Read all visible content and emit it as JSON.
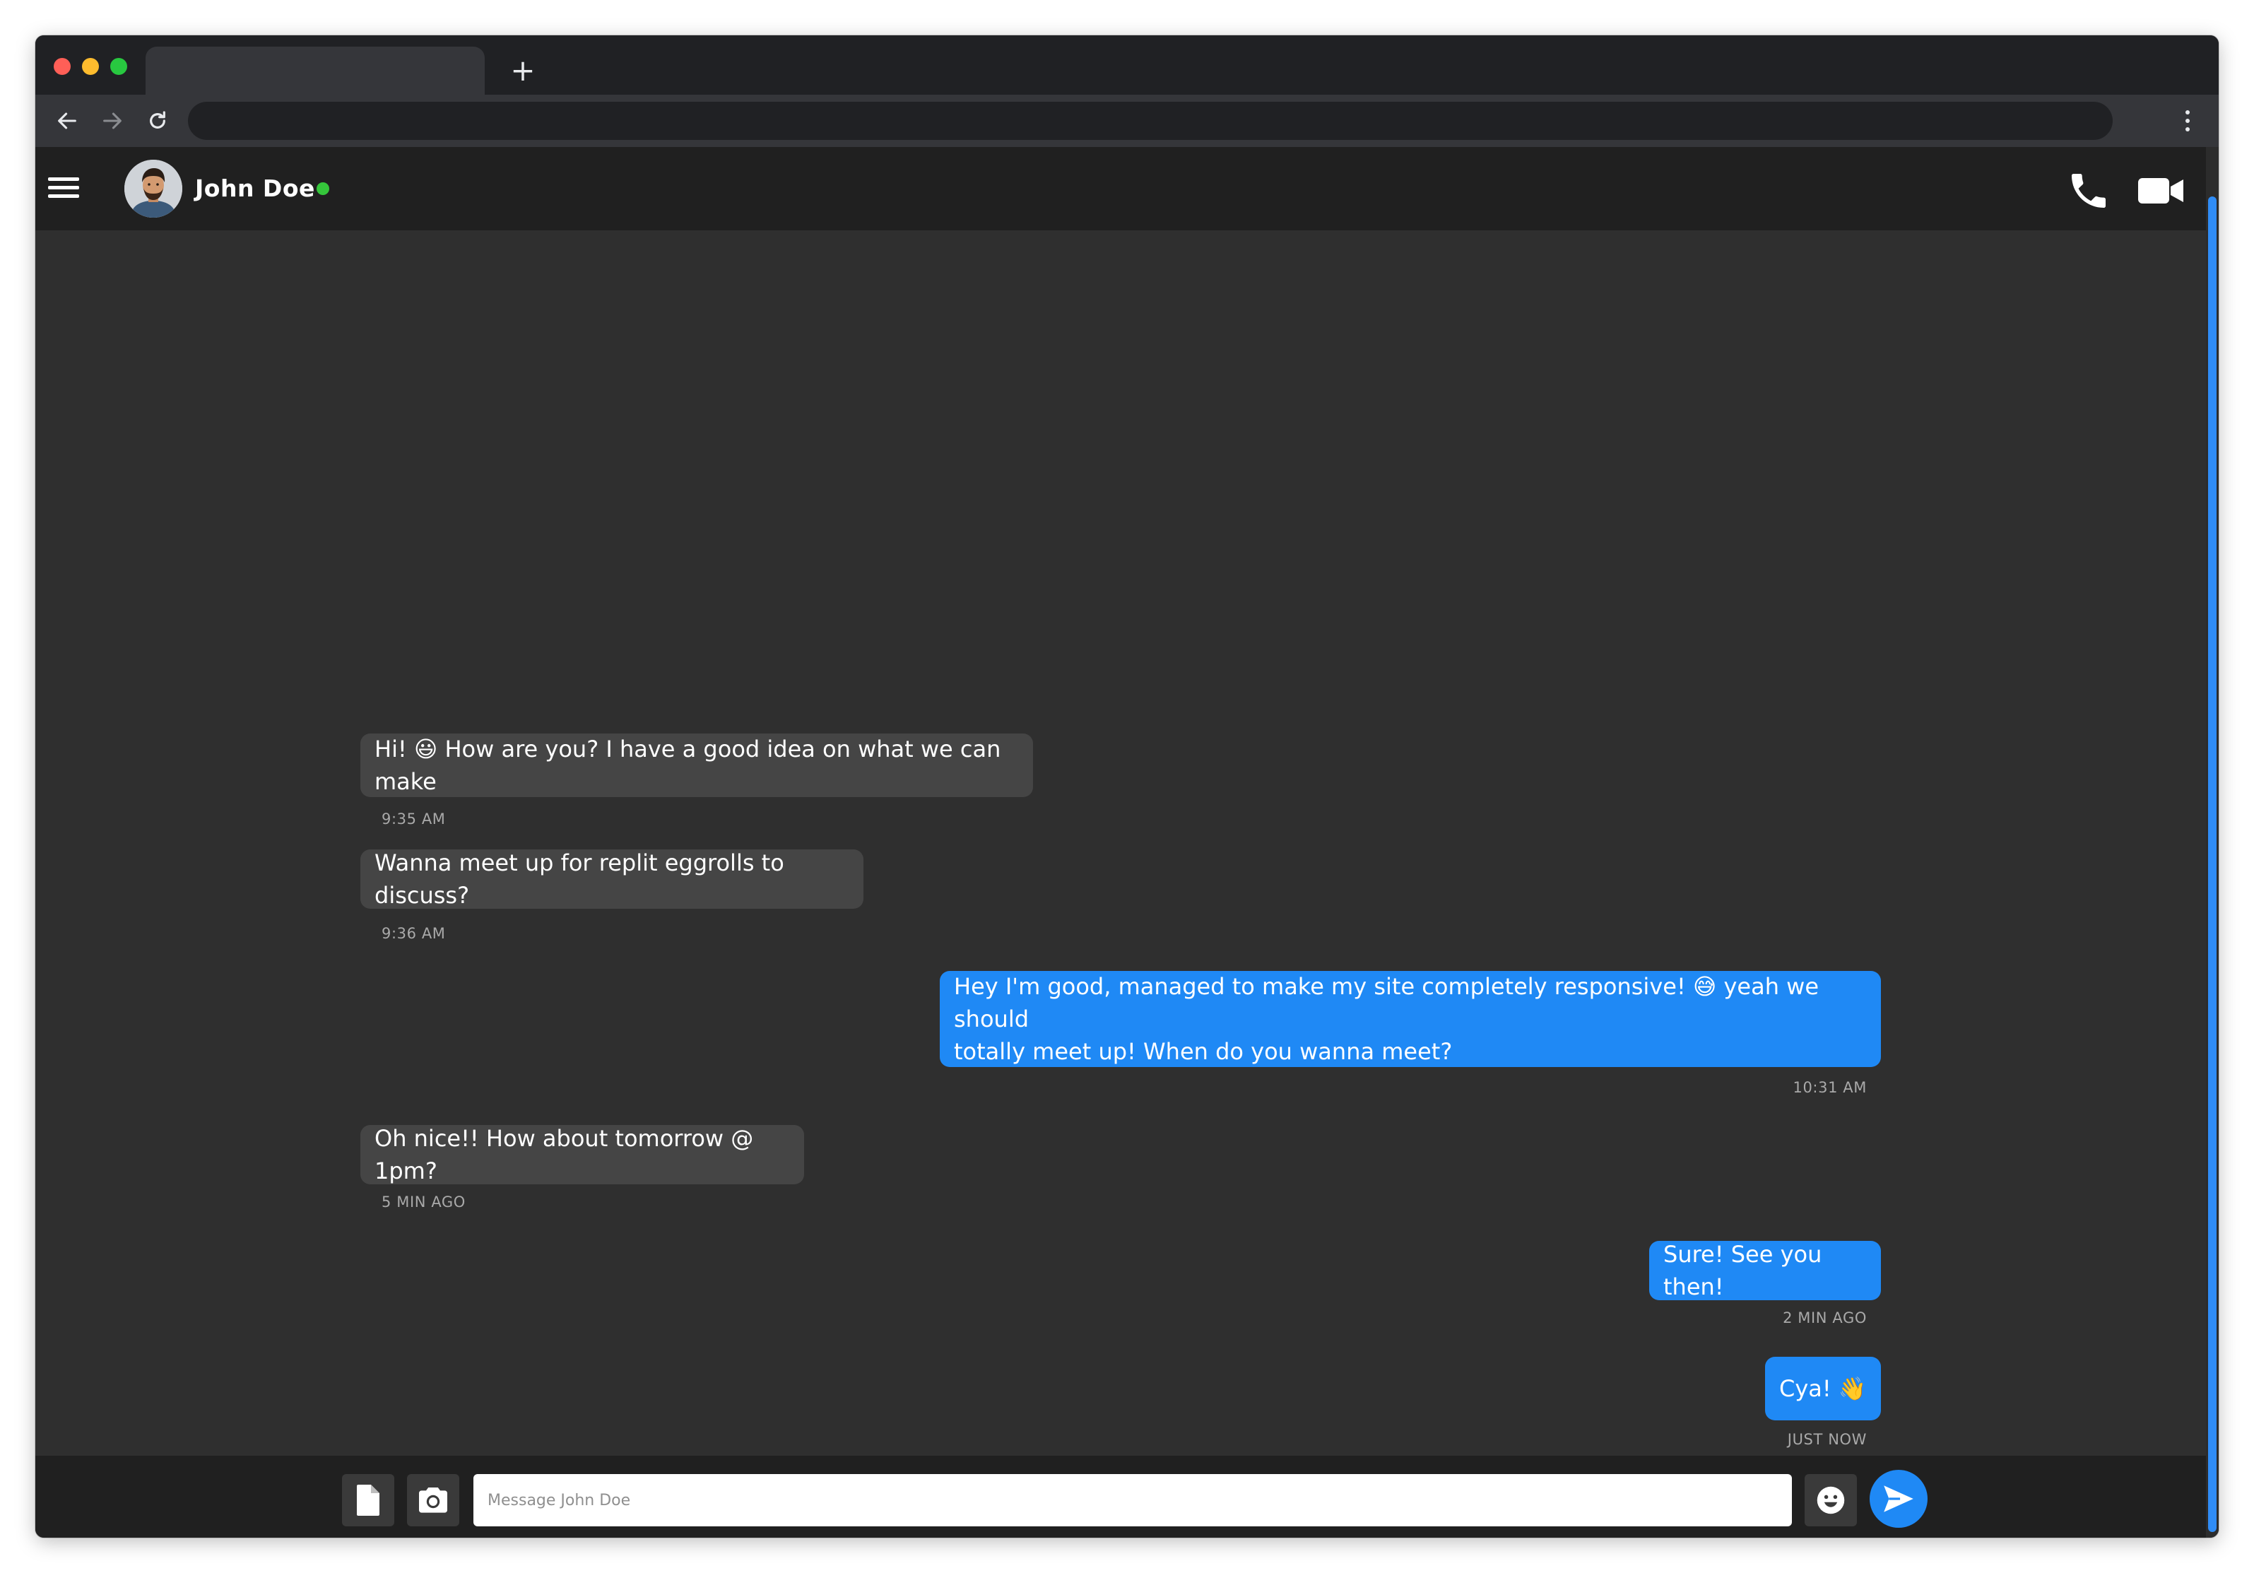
{
  "browser": {
    "new_tab_label": "+"
  },
  "header": {
    "contact_name": "John Doe",
    "online_color": "#35c63b",
    "icons": [
      "menu-icon",
      "phone-icon",
      "video-camera-icon"
    ]
  },
  "messages": [
    {
      "direction": "incoming",
      "text": "Hi! 😃 How are you? I have a good idea on what we can make",
      "time": "9:35 AM"
    },
    {
      "direction": "incoming",
      "text": "Wanna meet up for replit eggrolls to discuss?",
      "time": "9:36 AM"
    },
    {
      "direction": "outgoing",
      "line1": "Hey I'm good, managed to make my site completely responsive! 😅 yeah we should",
      "line2": "totally meet up! When do you wanna meet?",
      "time": "10:31 AM"
    },
    {
      "direction": "incoming",
      "text": "Oh nice!! How about tomorrow @ 1pm?",
      "time": "5 MIN AGO"
    },
    {
      "direction": "outgoing",
      "text": "Sure! See you then!",
      "time": "2 MIN AGO"
    },
    {
      "direction": "outgoing",
      "text": "Cya! 👋",
      "time": "JUST NOW"
    }
  ],
  "composer": {
    "placeholder": "Message John Doe",
    "icons": [
      "file-icon",
      "camera-icon",
      "emoji-icon",
      "send-icon"
    ]
  },
  "colors": {
    "accent": "#1f89f5",
    "incoming_bubble": "#454545",
    "background": "#2f2f2f"
  }
}
